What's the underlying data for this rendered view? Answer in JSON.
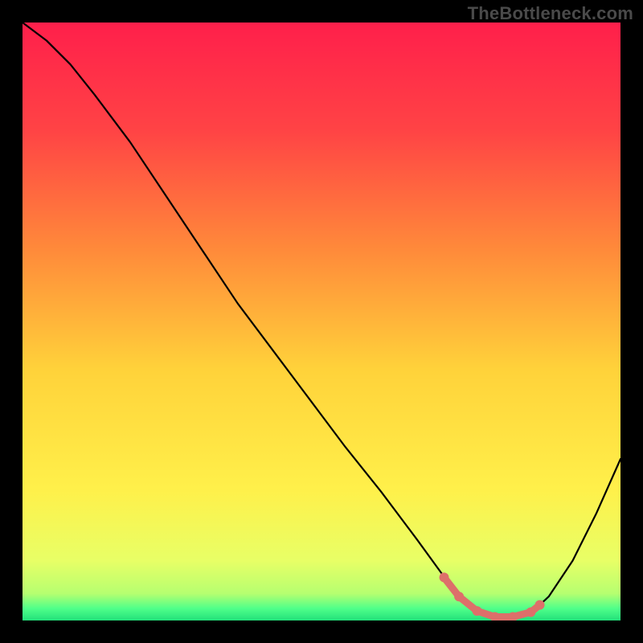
{
  "watermark": "TheBottleneck.com",
  "colors": {
    "frame_bg": "#000000",
    "curve": "#000000",
    "flat_marker": "#dd6f6a",
    "watermark": "#4a4a4a"
  },
  "chart_data": {
    "type": "line",
    "title": "",
    "xlabel": "",
    "ylabel": "",
    "xlim": [
      0,
      100
    ],
    "ylim": [
      0,
      100
    ],
    "gradient_stops": [
      {
        "offset": 0.0,
        "color": "#ff1f4b"
      },
      {
        "offset": 0.18,
        "color": "#ff4345"
      },
      {
        "offset": 0.38,
        "color": "#ff8a3a"
      },
      {
        "offset": 0.58,
        "color": "#ffd23a"
      },
      {
        "offset": 0.78,
        "color": "#fff04a"
      },
      {
        "offset": 0.9,
        "color": "#e8ff66"
      },
      {
        "offset": 0.955,
        "color": "#b6ff70"
      },
      {
        "offset": 0.98,
        "color": "#4fff8a"
      },
      {
        "offset": 1.0,
        "color": "#22e07a"
      }
    ],
    "series": [
      {
        "name": "bottleneck_curve",
        "x": [
          0,
          4,
          8,
          12,
          18,
          24,
          30,
          36,
          42,
          48,
          54,
          60,
          66,
          70,
          73,
          76,
          79,
          82,
          85,
          88,
          92,
          96,
          100
        ],
        "y": [
          100,
          97,
          93,
          88,
          80,
          71,
          62,
          53,
          45,
          37,
          29,
          21.5,
          13.5,
          8,
          4,
          1.5,
          0.5,
          0.5,
          1.2,
          4,
          10,
          18,
          27
        ]
      }
    ],
    "flat_region": {
      "x": [
        70.5,
        73,
        76,
        79,
        82,
        85,
        86.5
      ],
      "y": [
        7.2,
        4.0,
        1.6,
        0.6,
        0.6,
        1.4,
        2.6
      ]
    }
  }
}
